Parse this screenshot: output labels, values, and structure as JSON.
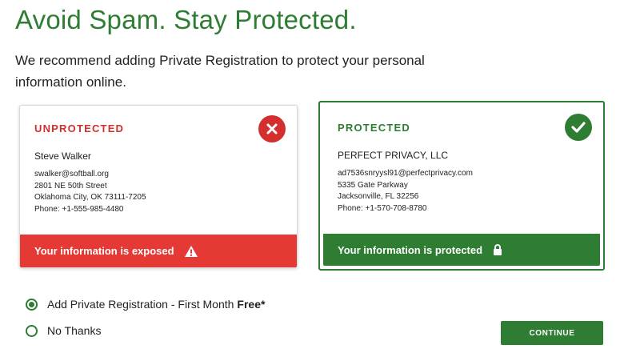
{
  "header": {
    "title": "Avoid Spam. Stay Protected.",
    "subtitle": "We recommend adding Private Registration to protect your personal information online."
  },
  "cards": {
    "unprotected": {
      "status": "UNPROTECTED",
      "icon": "x-icon",
      "name": "Steve Walker",
      "email": "swalker@softball.org",
      "address1": "2801 NE 50th Street",
      "address2": "Oklahoma City, OK 73111-7205",
      "phone": "Phone: +1-555-985-4480",
      "banner": "Your information is exposed",
      "banner_icon": "warning-icon",
      "color": "#e53935"
    },
    "protected": {
      "status": "PROTECTED",
      "icon": "check-icon",
      "name": "PERFECT PRIVACY, LLC",
      "email": "ad7536snryysl91@perfectprivacy.com",
      "address1": "5335 Gate Parkway",
      "address2": "Jacksonville, FL 32256",
      "phone": "Phone: +1-570-708-8780",
      "banner": "Your information is protected",
      "banner_icon": "lock-icon",
      "color": "#2e7d32"
    }
  },
  "options": {
    "add_private": {
      "label": "Add Private Registration - First Month",
      "emphasis": "Free*",
      "selected": true
    },
    "no_thanks": {
      "label": "No Thanks",
      "selected": false
    }
  },
  "continue_label": "CONTINUE"
}
